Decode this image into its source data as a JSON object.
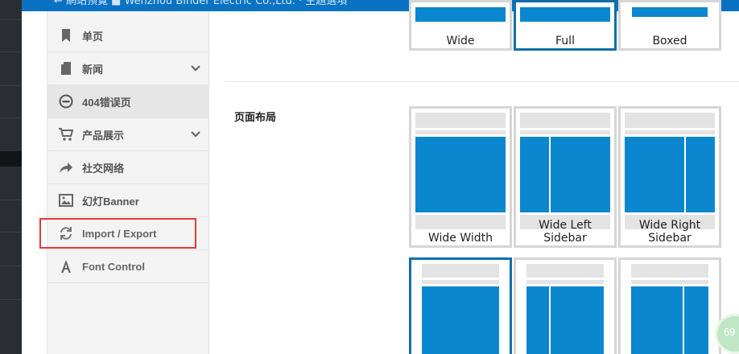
{
  "topbar": {
    "text": "← 網站預覽   ■   Wenzhou Binder Electric Co.,Ltd. · 主題選項"
  },
  "nav": {
    "items": [
      {
        "label": "单页",
        "icon": "bookmark-icon"
      },
      {
        "label": "新闻",
        "icon": "document-icon",
        "has_children": true
      },
      {
        "label": "404错误页",
        "icon": "minus-circle-icon"
      },
      {
        "label": "产品展示",
        "icon": "cart-icon",
        "has_children": true
      },
      {
        "label": "社交网络",
        "icon": "share-icon"
      },
      {
        "label": "幻灯Banner",
        "icon": "image-icon"
      },
      {
        "label": "Import / Export",
        "icon": "refresh-icon"
      },
      {
        "label": "Font Control",
        "icon": "font-icon"
      }
    ]
  },
  "body_layout": {
    "options": [
      {
        "label": "Wide"
      },
      {
        "label": "Full"
      },
      {
        "label": "Boxed"
      }
    ],
    "selected": "Full"
  },
  "page_layout": {
    "label": "页面布局",
    "options": [
      {
        "label": "Wide Width"
      },
      {
        "label": "Wide Left Sidebar"
      },
      {
        "label": "Wide Right Sidebar"
      }
    ]
  },
  "badge": {
    "text": "69"
  },
  "colors": {
    "accent": "#0b87cf",
    "selected_border": "#0e6fa8",
    "topbar": "#0a72c2",
    "highlight_box": "#e23b3b"
  }
}
